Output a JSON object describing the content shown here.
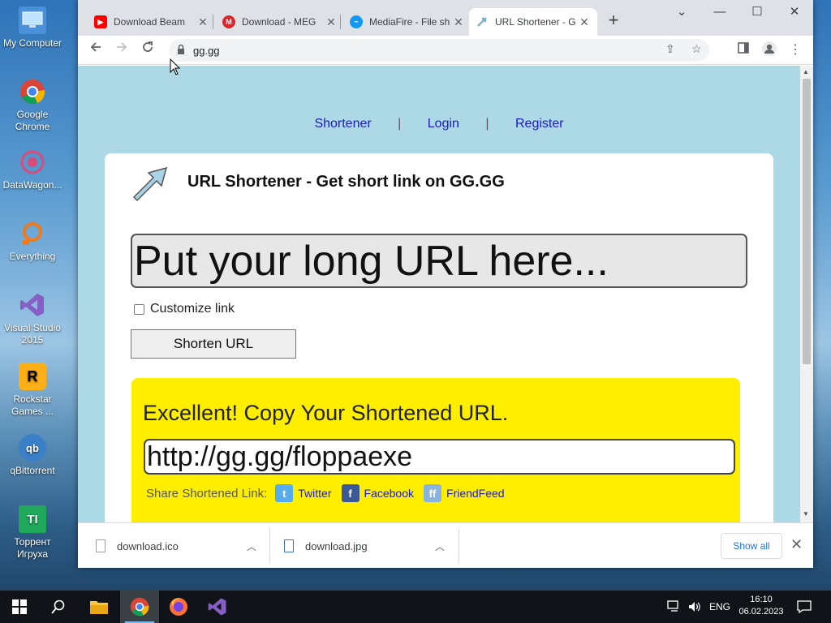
{
  "desktop": {
    "icons": [
      {
        "label": "My Computer"
      },
      {
        "label": "Google Chrome"
      },
      {
        "label": "DataWagon..."
      },
      {
        "label": "Everything"
      },
      {
        "label": "Visual Studio 2015"
      },
      {
        "label": "Rockstar Games ..."
      },
      {
        "label": "qBittorrent"
      },
      {
        "label": "Торрент Игруха"
      }
    ]
  },
  "browser": {
    "tabs": [
      {
        "title": "Download Beam",
        "icon": "youtube-icon",
        "color": "#ff0000"
      },
      {
        "title": "Download - MEG",
        "icon": "mega-icon",
        "color": "#d9272e"
      },
      {
        "title": "MediaFire - File sh",
        "icon": "mediafire-icon",
        "color": "#1299f3"
      },
      {
        "title": "URL Shortener - G",
        "icon": "ggg-icon",
        "color": "#7fb2c8"
      }
    ],
    "new_tab": "+",
    "address": "gg.gg"
  },
  "page": {
    "nav": [
      "Shortener",
      "Login",
      "Register"
    ],
    "nav_sep": "|",
    "heading": "URL Shortener - Get short link on GG.GG",
    "url_placeholder": "Put your long URL here...",
    "customize_label": "Customize link",
    "shorten_button": "Shorten URL",
    "result_headline": "Excellent! Copy Your Shortened URL.",
    "short_url": "http://gg.gg/floppaexe",
    "share_label": "Share Shortened Link:",
    "share_links": [
      {
        "label": "Twitter",
        "icon": "twitter-icon",
        "color": "#55acee"
      },
      {
        "label": "Facebook",
        "icon": "facebook-icon",
        "color": "#3b5998"
      },
      {
        "label": "FriendFeed",
        "icon": "friendfeed-icon",
        "color": "#8ab4e0"
      }
    ]
  },
  "downloads": {
    "items": [
      {
        "name": "download.ico"
      },
      {
        "name": "download.jpg"
      }
    ],
    "show_all": "Show all"
  },
  "taskbar": {
    "language": "ENG",
    "time": "16:10",
    "date": "06.02.2023"
  }
}
